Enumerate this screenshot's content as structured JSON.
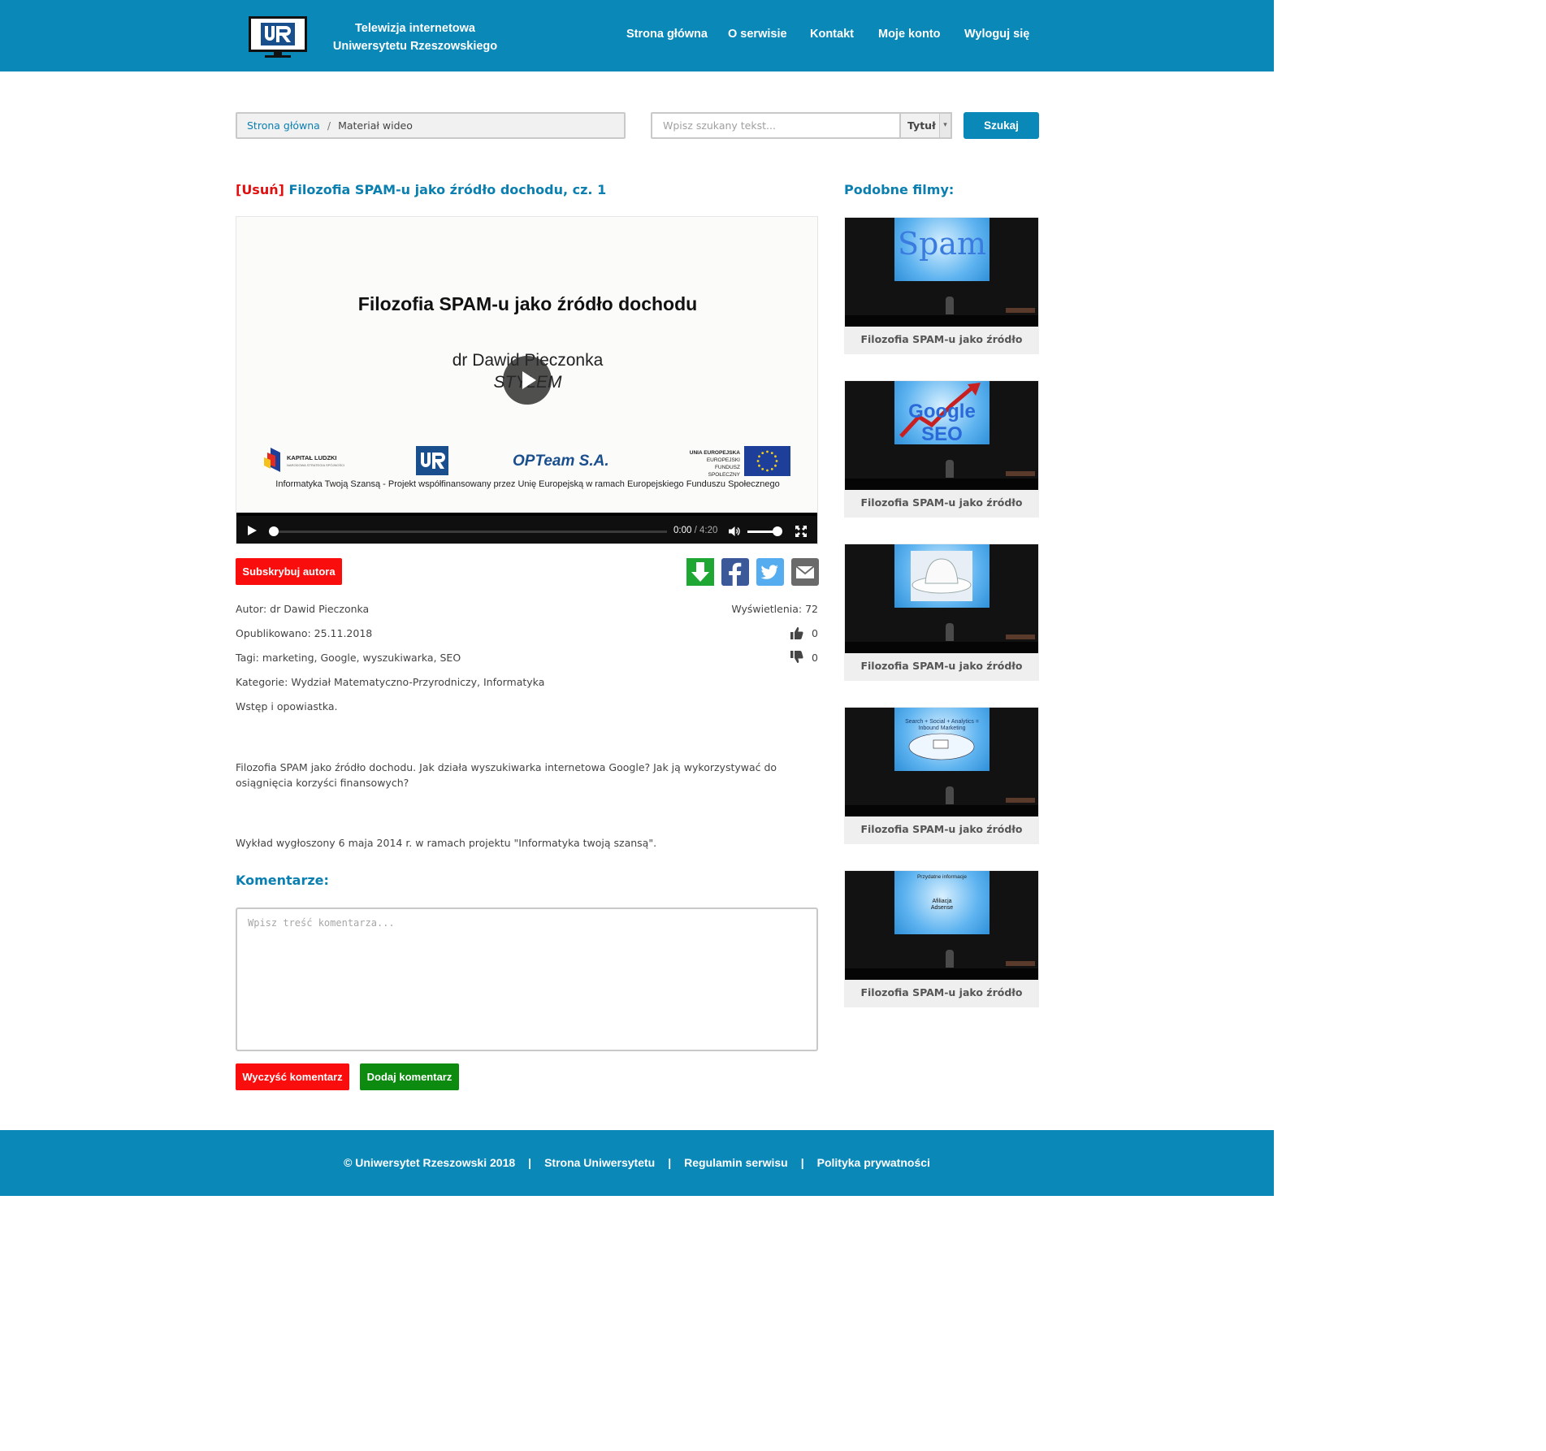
{
  "header": {
    "title_line1": "Telewizja internetowa",
    "title_line2": "Uniwersytetu Rzeszowskiego",
    "nav": [
      "Strona główna",
      "O serwisie",
      "Kontakt",
      "Moje konto",
      "Wyloguj się"
    ],
    "brand_color": "#0a88b8"
  },
  "breadcrumb": {
    "home": "Strona główna",
    "separator": "/",
    "current": "Materiał wideo"
  },
  "search": {
    "placeholder": "Wpisz szukany tekst...",
    "select_value": "Tytuł",
    "button": "Szukaj"
  },
  "video": {
    "delete_label": "[Usuń]",
    "title": "Filozofia SPAM-u jako źródło dochodu, cz. 1",
    "slide": {
      "title": "Filozofia SPAM-u jako źródło dochodu",
      "author": "dr Dawid Pieczonka",
      "org": "STYLEM",
      "logo_kapital": "KAPITAŁ LUDZKI",
      "logo_kapital_sub": "NARODOWA STRATEGIA SPÓJNOŚCI",
      "logo_opteam": "OPTeam S.A.",
      "logo_ue_line1": "UNIA EUROPEJSKA",
      "logo_ue_line2": "EUROPEJSKI",
      "logo_ue_line3": "FUNDUSZ SPOŁECZNY",
      "footer": "Informatyka Twoją Szansą - Projekt współfinansowany przez Unię Europejską w ramach Europejskiego Funduszu Społecznego"
    },
    "player": {
      "time_current": "0:00",
      "time_separator": "/",
      "duration": "4:20",
      "progress": 0,
      "volume": 0.85
    }
  },
  "actions": {
    "subscribe": "Subskrybuj autora",
    "share_icons": [
      "download-icon",
      "facebook-icon",
      "twitter-icon",
      "email-icon"
    ]
  },
  "meta": {
    "author_label": "Autor:",
    "author": "dr Dawid Pieczonka",
    "published_label": "Opublikowano:",
    "published": "25.11.2018",
    "tags_label": "Tagi:",
    "tags": "marketing, Google, wyszukiwarka, SEO",
    "categories_label": "Kategorie:",
    "categories": "Wydział Matematyczno-Przyrodniczy, Informatyka",
    "views_label": "Wyświetlenia:",
    "views": "72",
    "likes": "0",
    "dislikes": "0"
  },
  "description": {
    "p1": "Wstęp i opowiastka.",
    "p2": "Filozofia SPAM jako źródło dochodu. Jak działa wyszukiwarka internetowa Google? Jak ją wykorzystywać do osiągnięcia korzyści finansowych?",
    "p3": "Wykład wygłoszony 6 maja 2014 r. w ramach projektu \"Informatyka twoją szansą\"."
  },
  "comments": {
    "title": "Komentarze:",
    "placeholder": "Wpisz treść komentarza...",
    "clear": "Wyczyść komentarz",
    "add": "Dodaj komentarz"
  },
  "sidebar": {
    "title": "Podobne filmy:",
    "items": [
      {
        "label": "Filozofia SPAM-u jako źródło",
        "screen_text": "Spam"
      },
      {
        "label": "Filozofia SPAM-u jako źródło",
        "screen_text": "Google SEO"
      },
      {
        "label": "Filozofia SPAM-u jako źródło",
        "screen_text": ""
      },
      {
        "label": "Filozofia SPAM-u jako źródło",
        "screen_text": "Search + Social + Analytics = Inbound Marketing"
      },
      {
        "label": "Filozofia SPAM-u jako źródło",
        "screen_text": "Przydatne informacje",
        "screen_text2": "Afiliacja",
        "screen_text3": "Adsense"
      }
    ]
  },
  "footer": {
    "copyright": "© Uniwersytet Rzeszowski 2018",
    "links": [
      "Strona Uniwersytetu",
      "Regulamin serwisu",
      "Polityka prywatności"
    ],
    "separator": "|"
  }
}
